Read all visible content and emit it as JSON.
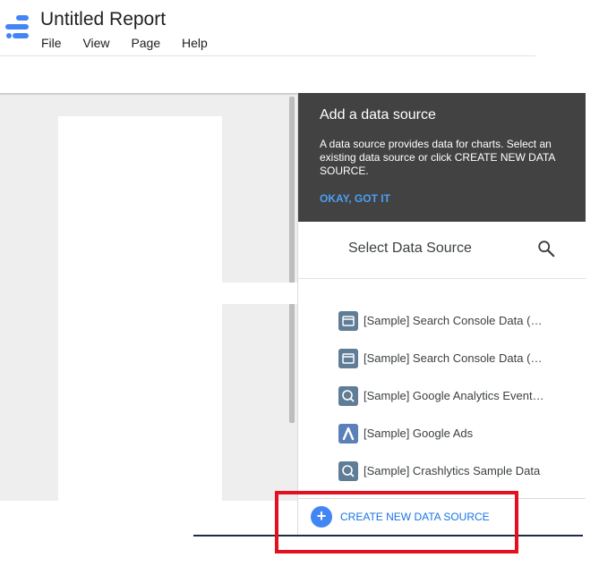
{
  "app": {
    "title": "Untitled Report"
  },
  "menu": [
    "File",
    "View",
    "Page",
    "Help"
  ],
  "colors": {
    "accent": "#4285f4",
    "tip_bg": "#424242",
    "highlight": "#e3101f"
  },
  "tip": {
    "title": "Add a data source",
    "body": "A data source provides data for charts. Select an existing data source or click CREATE NEW DATA SOURCE.",
    "ok": "OKAY, GOT IT"
  },
  "panel": {
    "title": "Select Data Source",
    "search_icon": "search-icon"
  },
  "sources": [
    {
      "label": "[Sample] Search Console Data (Site Impression)",
      "icon": "search-console-icon"
    },
    {
      "label": "[Sample] Search Console Data (URL Impression)",
      "icon": "search-console-icon"
    },
    {
      "label": "[Sample] Google Analytics Events Data",
      "icon": "analytics-icon"
    },
    {
      "label": "[Sample] Google Ads",
      "icon": "google-ads-icon"
    },
    {
      "label": "[Sample] Crashlytics Sample Data",
      "icon": "crashlytics-icon"
    }
  ],
  "create": {
    "label": "CREATE NEW DATA SOURCE",
    "icon": "plus-icon"
  }
}
